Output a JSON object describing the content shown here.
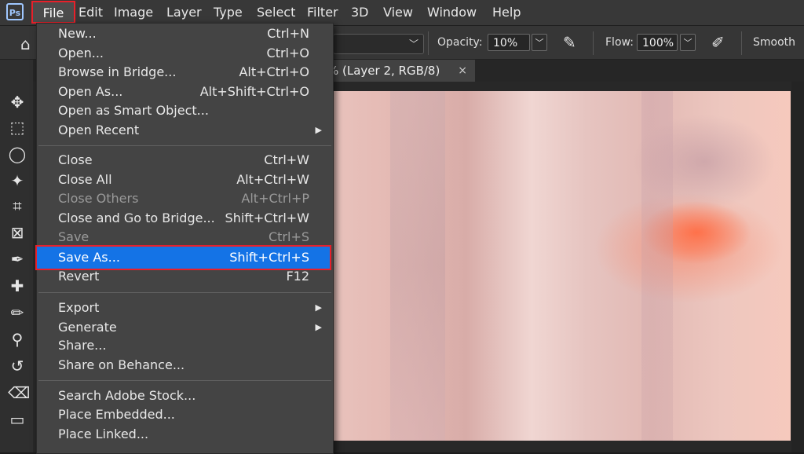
{
  "menubar": {
    "items": [
      "File",
      "Edit",
      "Image",
      "Layer",
      "Type",
      "Select",
      "Filter",
      "3D",
      "View",
      "Window",
      "Help"
    ]
  },
  "options": {
    "opacity_label": "Opacity:",
    "opacity_value": "10%",
    "flow_label": "Flow:",
    "flow_value": "100%",
    "smooth_label": "Smooth"
  },
  "document_tab": {
    "title": "% (Layer 2, RGB/8)",
    "close": "×"
  },
  "file_menu": {
    "items": [
      {
        "label": "New...",
        "shortcut": "Ctrl+N"
      },
      {
        "label": "Open...",
        "shortcut": "Ctrl+O"
      },
      {
        "label": "Browse in Bridge...",
        "shortcut": "Alt+Ctrl+O"
      },
      {
        "label": "Open As...",
        "shortcut": "Alt+Shift+Ctrl+O"
      },
      {
        "label": "Open as Smart Object...",
        "shortcut": ""
      },
      {
        "label": "Open Recent",
        "shortcut": ""
      },
      {
        "label": "Close",
        "shortcut": "Ctrl+W"
      },
      {
        "label": "Close All",
        "shortcut": "Alt+Ctrl+W"
      },
      {
        "label": "Close Others",
        "shortcut": "Alt+Ctrl+P"
      },
      {
        "label": "Close and Go to Bridge...",
        "shortcut": "Shift+Ctrl+W"
      },
      {
        "label": "Save",
        "shortcut": "Ctrl+S"
      },
      {
        "label": "Save As...",
        "shortcut": "Shift+Ctrl+S"
      },
      {
        "label": "Revert",
        "shortcut": "F12"
      },
      {
        "label": "Export",
        "shortcut": ""
      },
      {
        "label": "Generate",
        "shortcut": ""
      },
      {
        "label": "Share...",
        "shortcut": ""
      },
      {
        "label": "Share on Behance...",
        "shortcut": ""
      },
      {
        "label": "Search Adobe Stock...",
        "shortcut": ""
      },
      {
        "label": "Place Embedded...",
        "shortcut": ""
      },
      {
        "label": "Place Linked...",
        "shortcut": ""
      }
    ]
  },
  "colors": {
    "highlight": "#1473e6",
    "annotation_red": "#e8202a"
  }
}
